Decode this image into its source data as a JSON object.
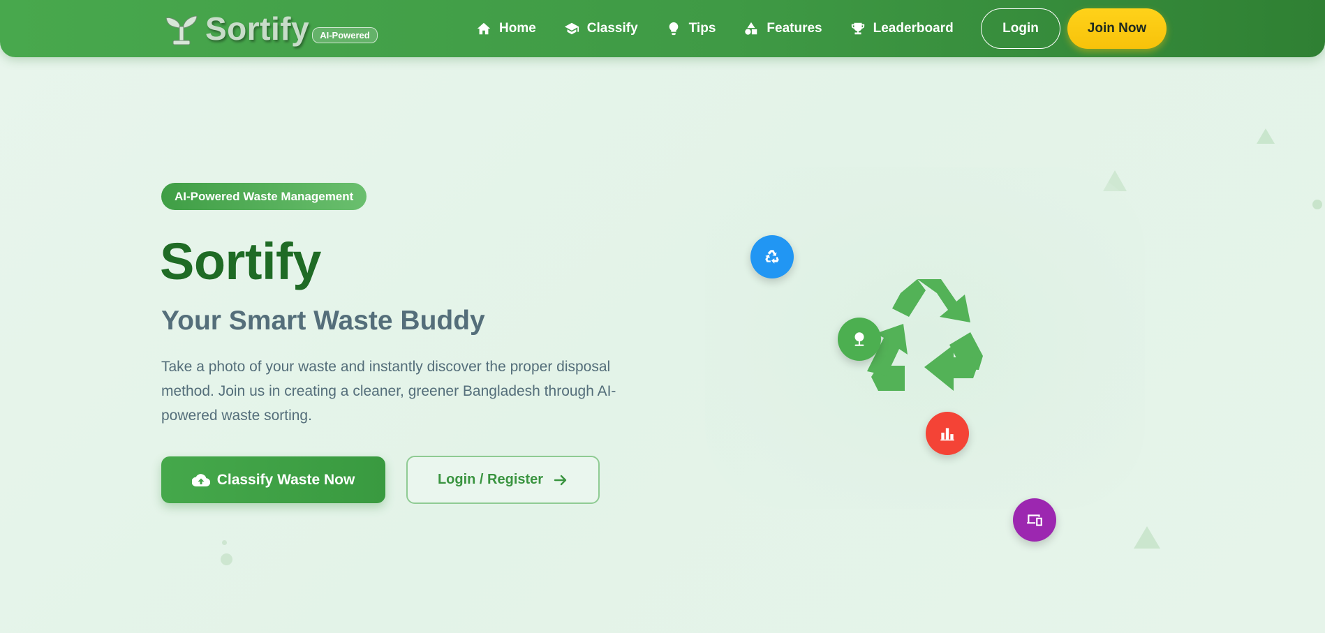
{
  "brand": {
    "name": "Sortify",
    "badge": "AI-Powered",
    "logo_icon": "sprout-icon"
  },
  "nav": {
    "items": [
      {
        "label": "Home",
        "icon": "home-icon"
      },
      {
        "label": "Classify",
        "icon": "graduation-cap-icon"
      },
      {
        "label": "Tips",
        "icon": "lightbulb-icon"
      },
      {
        "label": "Features",
        "icon": "shapes-icon"
      },
      {
        "label": "Leaderboard",
        "icon": "trophy-icon"
      }
    ],
    "login_label": "Login",
    "join_label": "Join Now"
  },
  "hero": {
    "pill": "AI-Powered Waste Management",
    "title": "Sortify",
    "subtitle": "Your Smart Waste Buddy",
    "description": "Take a photo of your waste and instantly discover the proper disposal method. Join us in creating a cleaner, greener Bangladesh through AI-powered waste sorting.",
    "primary_button": "Classify Waste Now",
    "primary_icon": "cloud-upload-icon",
    "secondary_button": "Login / Register",
    "secondary_icon": "arrow-right-icon"
  },
  "illustration": {
    "center_icon": "recycle-icon",
    "floating_icons": [
      {
        "icon": "recycle-small-icon",
        "color": "#2196f3"
      },
      {
        "icon": "tree-icon",
        "color": "#4caf50"
      },
      {
        "icon": "bar-chart-icon",
        "color": "#f44336"
      },
      {
        "icon": "devices-icon",
        "color": "#9c27b0"
      }
    ]
  },
  "colors": {
    "primary": "#43a047",
    "dark_green": "#1f6b25",
    "accent_yellow": "#ffd21a",
    "text_gray": "#546e7a"
  }
}
